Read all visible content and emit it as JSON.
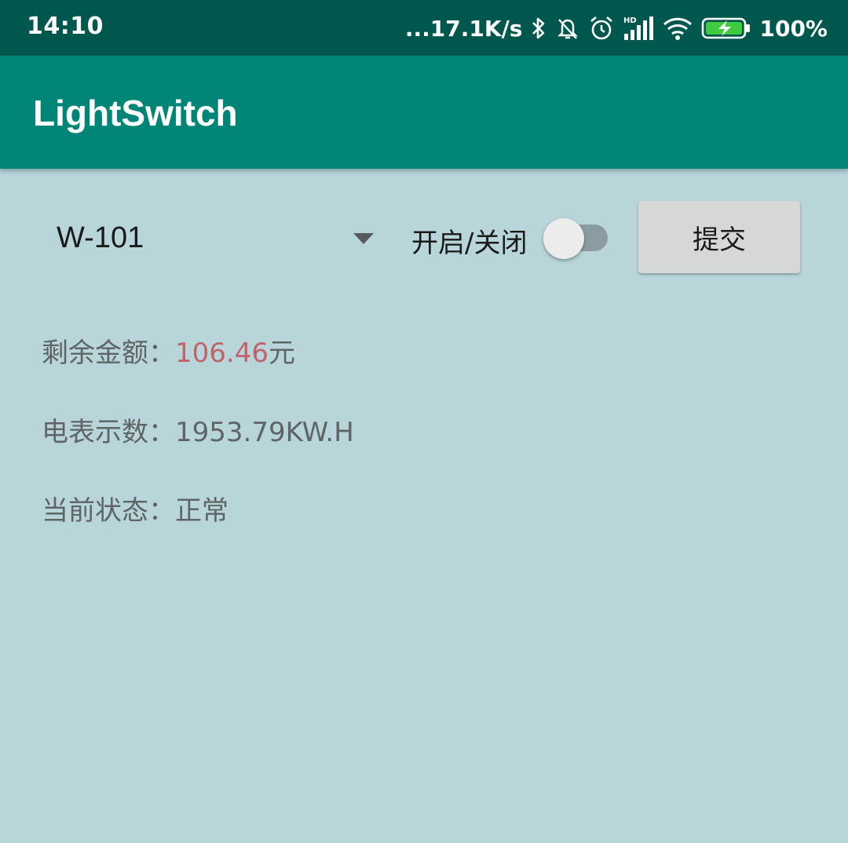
{
  "status_bar": {
    "time": "14:10",
    "network_speed": "...17.1K/s",
    "network_label": "HD",
    "battery_percent": "100%",
    "icons": [
      "bluetooth-icon",
      "bell-off-icon",
      "alarm-icon",
      "signal-icon",
      "wifi-icon",
      "battery-charging-icon"
    ]
  },
  "app_bar": {
    "title": "LightSwitch",
    "color": "#008577"
  },
  "controls": {
    "spinner_value": "W-101",
    "switch_label": "开启/关闭",
    "switch_on": false,
    "submit_label": "提交"
  },
  "info": {
    "balance_label": "剩余金额：",
    "balance_value": "106.46",
    "balance_unit": "元",
    "meter_label": "电表示数：",
    "meter_value": "1953.79KW.H",
    "status_label": "当前状态：",
    "status_value": "正常",
    "accent_color": "#c0646a"
  }
}
